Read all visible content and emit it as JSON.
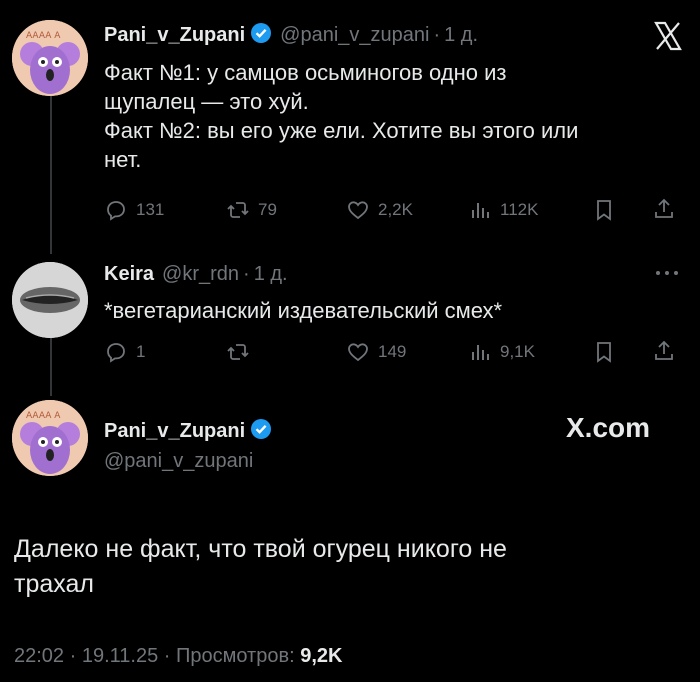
{
  "brand": {
    "x_logo": "X",
    "x_com": "X.com",
    "accent": "#1d9bf0",
    "bg": "#000000"
  },
  "tweet1": {
    "name": "Pani_v_Zupani",
    "handle": "@pani_v_zupani",
    "time": "1 д.",
    "lines": [
      "Факт №1: у самцов осьминогов одно из",
      "щупалец — это хуй.",
      "Факт №2: вы его уже ели. Хотите вы этого или",
      "нет."
    ],
    "stats": {
      "replies": "131",
      "retweets": "79",
      "likes": "2,2K",
      "views": "112K"
    }
  },
  "tweet2": {
    "name": "Keira",
    "handle": "@kr_rdn",
    "time": "1 д.",
    "text": "*вегетарианский издевательский смех*",
    "stats": {
      "replies": "1",
      "retweets": "",
      "likes": "149",
      "views": "9,1K"
    }
  },
  "tweet3": {
    "name": "Pani_v_Zupani",
    "handle": "@pani_v_zupani",
    "lines": [
      "Далеко не факт, что твой огурец никого не",
      "трахал"
    ],
    "footer": {
      "time": "22:02",
      "date": "19.11.25",
      "views_label": "Просмотров:",
      "views_value": "9,2K"
    }
  }
}
